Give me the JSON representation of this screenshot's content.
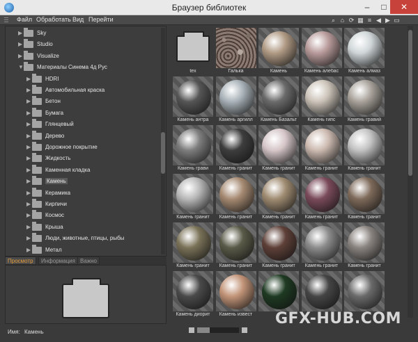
{
  "window": {
    "title": "Браузер библиотек"
  },
  "menu": [
    "Файл",
    "Обработать",
    "Вид",
    "Перейти"
  ],
  "tree": [
    {
      "label": "Sky",
      "level": 1,
      "expanded": false
    },
    {
      "label": "Studio",
      "level": 1,
      "expanded": false
    },
    {
      "label": "Visualize",
      "level": 1,
      "expanded": false
    },
    {
      "label": "Материалы Синема 4д Рус",
      "level": 1,
      "expanded": true
    },
    {
      "label": "HDRI",
      "level": 2
    },
    {
      "label": "Автомобильная краска",
      "level": 2
    },
    {
      "label": "Бетон",
      "level": 2
    },
    {
      "label": "Бумага",
      "level": 2
    },
    {
      "label": "Глянцевый",
      "level": 2
    },
    {
      "label": "Дерево",
      "level": 2
    },
    {
      "label": "Дорожное покрытие",
      "level": 2
    },
    {
      "label": "Жидкость",
      "level": 2
    },
    {
      "label": "Каменная кладка",
      "level": 2
    },
    {
      "label": "Камень",
      "level": 2,
      "selected": true
    },
    {
      "label": "Керамика",
      "level": 2
    },
    {
      "label": "Кирпичи",
      "level": 2
    },
    {
      "label": "Космос",
      "level": 2
    },
    {
      "label": "Крыша",
      "level": 2
    },
    {
      "label": "Люди, животные, птицы, рыбы",
      "level": 2
    },
    {
      "label": "Метал",
      "level": 2
    }
  ],
  "tabs": [
    {
      "label": "Просмотр",
      "active": true
    },
    {
      "label": "Информация",
      "active": false
    },
    {
      "label": "Важно",
      "active": false
    }
  ],
  "preview": {
    "name_label": "Имя:",
    "name_value": "Камень"
  },
  "materials": [
    {
      "caption": "tex",
      "kind": "folder"
    },
    {
      "caption": "Галька",
      "kind": "pebble"
    },
    {
      "caption": "Камень",
      "color": "#b09a84"
    },
    {
      "caption": "Камень алебас",
      "color": "#b89a9a"
    },
    {
      "caption": "Камень алмаз",
      "color": "#cfd6d8"
    },
    {
      "caption": "Камень антра",
      "color": "#555555"
    },
    {
      "caption": "Камень аргилл",
      "color": "#a8b2b8"
    },
    {
      "caption": "Камень Базальт",
      "color": "#6a6a6a"
    },
    {
      "caption": "Камень гипс",
      "color": "#cbc3b8"
    },
    {
      "caption": "Камень гравий",
      "color": "#a8a29a"
    },
    {
      "caption": "Камень грави",
      "color": "#7d7d7d"
    },
    {
      "caption": "Камень гранит",
      "color": "#3d3d3d"
    },
    {
      "caption": "Камень гранит",
      "color": "#d6c6c8"
    },
    {
      "caption": "Камень гранит",
      "color": "#ccbab0"
    },
    {
      "caption": "Камень гранит",
      "color": "#c2c2c2"
    },
    {
      "caption": "Камень гранит",
      "color": "#b8b8b8"
    },
    {
      "caption": "Камень гранит",
      "color": "#a68a72"
    },
    {
      "caption": "Камень гранит",
      "color": "#a08c72"
    },
    {
      "caption": "Камень гранит",
      "color": "#7a4a5a"
    },
    {
      "caption": "Камень гранит",
      "color": "#7e6a5a"
    },
    {
      "caption": "Камень гранит",
      "color": "#7a7258"
    },
    {
      "caption": "Камень гранит",
      "color": "#5a5a48"
    },
    {
      "caption": "Камень гранит",
      "color": "#5e4038"
    },
    {
      "caption": "Камень гранит",
      "color": "#8c8c8c"
    },
    {
      "caption": "Камень гранит",
      "color": "#8a8480"
    },
    {
      "caption": "Камень диорит",
      "color": "#4a4a4a"
    },
    {
      "caption": "Камень извест",
      "color": "#c29478"
    },
    {
      "caption": "",
      "color": "#1e3a22"
    },
    {
      "caption": "",
      "color": "#454545"
    },
    {
      "caption": "",
      "color": "#6a6a6a"
    }
  ],
  "watermark": "GFX-HUB.COM",
  "colors": {
    "accent": "#e39b3b",
    "panel": "#3d3d3d"
  },
  "zoom_slider": 0.3
}
